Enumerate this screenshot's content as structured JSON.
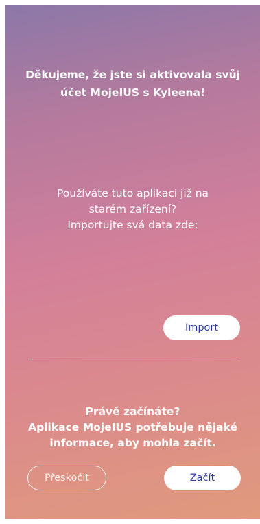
{
  "welcome": {
    "headline": "Děkujeme, že jste si aktivovala svůj účet MojeIUS s Kyleena!"
  },
  "import_section": {
    "line1": "Používáte tuto aplikaci již na",
    "line2": "starém zařízení?",
    "line3": "Importujte svá data zde:",
    "import_label": "Import"
  },
  "start_section": {
    "line1": "Právě začínáte?",
    "line2": "Aplikace MojeIUS potřebuje nějaké",
    "line3": "informace, aby mohla začít.",
    "skip_label": "Přeskočit",
    "start_label": "Začít"
  },
  "colors": {
    "gradient_top": "#8b78a8",
    "gradient_mid": "#d3809a",
    "gradient_bottom": "#e09a7c",
    "button_text": "#2c3aa8"
  }
}
